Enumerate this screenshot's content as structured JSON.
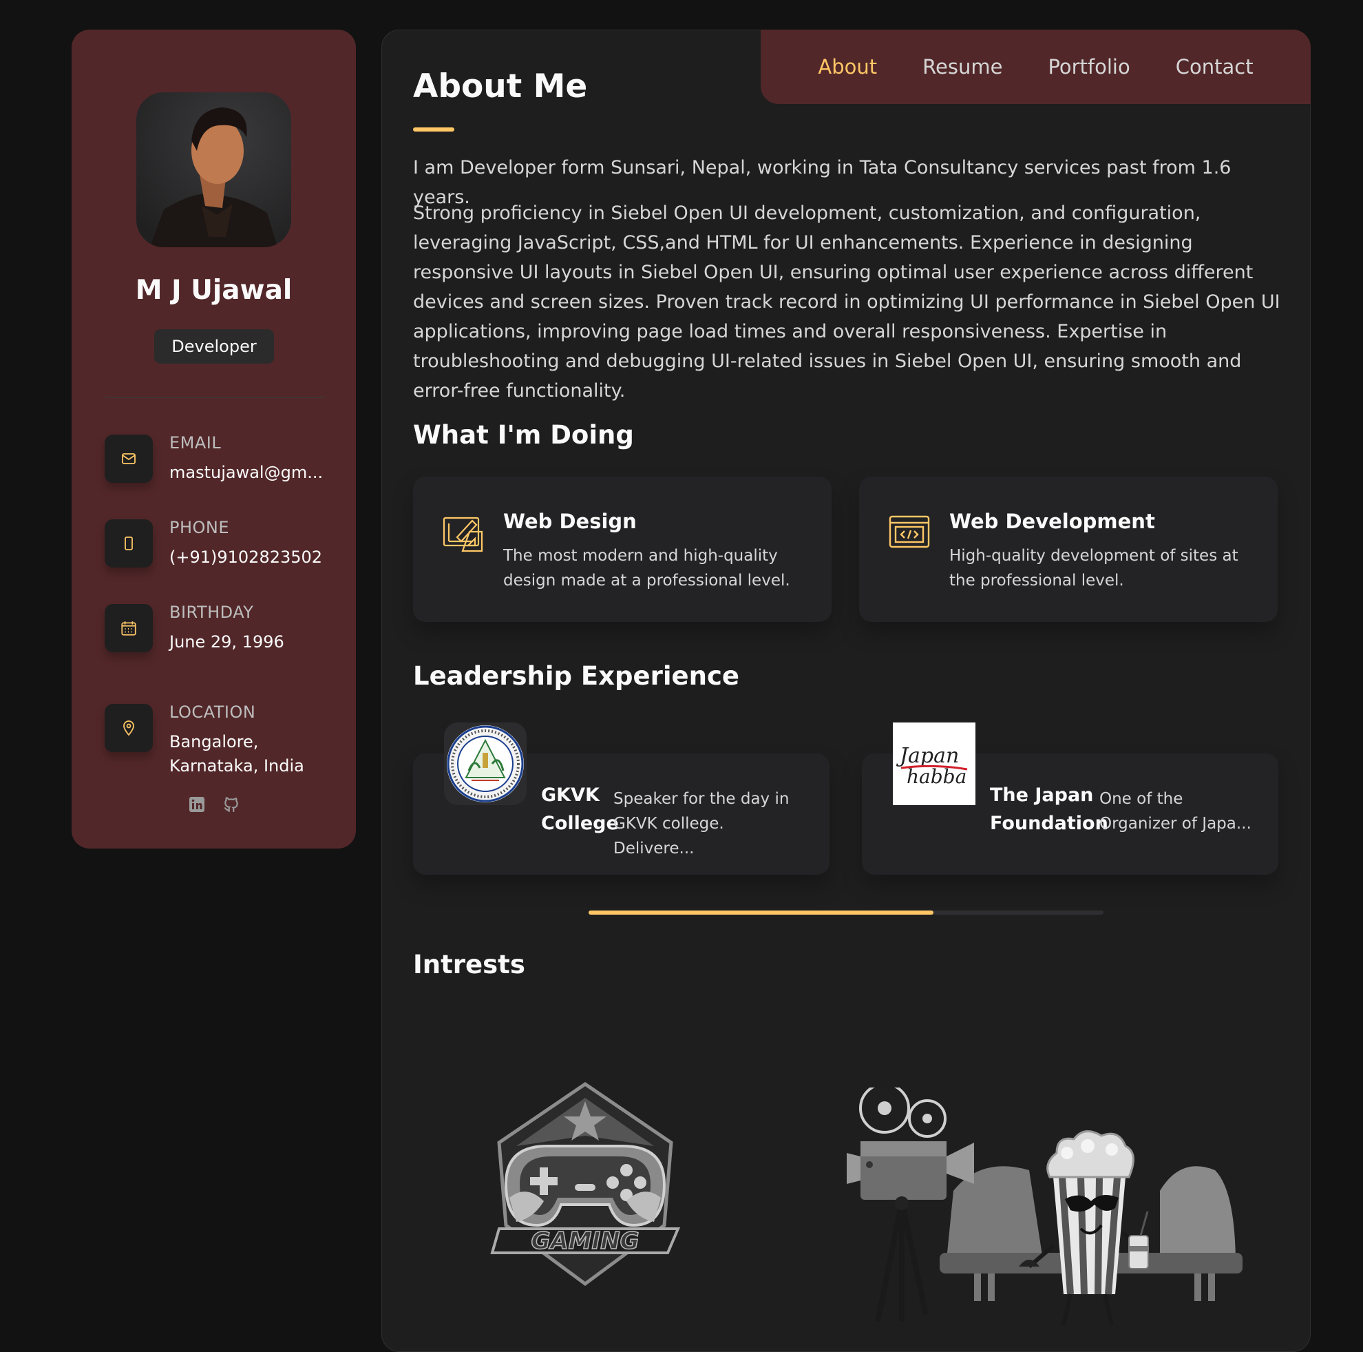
{
  "sidebar": {
    "name": "M J Ujawal",
    "role": "Developer",
    "contacts": [
      {
        "label": "EMAIL",
        "value": "mastujawal@gm...",
        "icon": "mail-icon"
      },
      {
        "label": "PHONE",
        "value": "(+91)9102823502",
        "icon": "phone-icon"
      },
      {
        "label": "BIRTHDAY",
        "value": "June 29, 1996",
        "icon": "calendar-icon"
      },
      {
        "label": "LOCATION",
        "value": "Bangalore, Karnataka, India",
        "icon": "location-pin-icon"
      }
    ],
    "socials": [
      "linkedin-icon",
      "github-icon"
    ]
  },
  "nav": {
    "items": [
      "About",
      "Resume",
      "Portfolio",
      "Contact"
    ],
    "active": "About"
  },
  "about": {
    "title": "About Me",
    "paragraphs": [
      "I am Developer form Sunsari, Nepal, working in Tata Consultancy services past from 1.6 years.",
      "Strong proficiency in Siebel Open UI development, customization, and configuration, leveraging JavaScript, CSS,and HTML for UI enhancements. Experience in designing responsive UI layouts in Siebel Open UI, ensuring optimal user experience across different devices and screen sizes. Proven track record in optimizing UI performance in Siebel Open UI applications, improving page load times and overall responsiveness. Expertise in troubleshooting and debugging UI-related issues in Siebel Open UI, ensuring smooth and error-free functionality."
    ]
  },
  "doing": {
    "title": "What I'm Doing",
    "services": [
      {
        "title": "Web Design",
        "text": "The most modern and high-quality design made at a professional level.",
        "icon": "design-icon"
      },
      {
        "title": "Web Development",
        "text": "High-quality development of sites at the professional level.",
        "icon": "code-icon"
      }
    ]
  },
  "leadership": {
    "title": "Leadership Experience",
    "items": [
      {
        "name": "GKVK College",
        "text": "Speaker for the day in GKVK college. Delivere...",
        "logo": "gkvk-seal-logo"
      },
      {
        "name": "The Japan Foundation",
        "text": "One of the Organizer of Japa...",
        "logo_text": [
          "Japan",
          "habba"
        ]
      }
    ],
    "scroll_progress": 0.67
  },
  "interests": {
    "title": "Intrests",
    "images": [
      "gaming-emblem",
      "movies-illustration"
    ],
    "gaming_text": "GAMING"
  },
  "colors": {
    "accent": "#ffc766",
    "sidebar_bg": "#522729",
    "panel_bg": "#1e1e1f",
    "page_bg": "#121212"
  }
}
